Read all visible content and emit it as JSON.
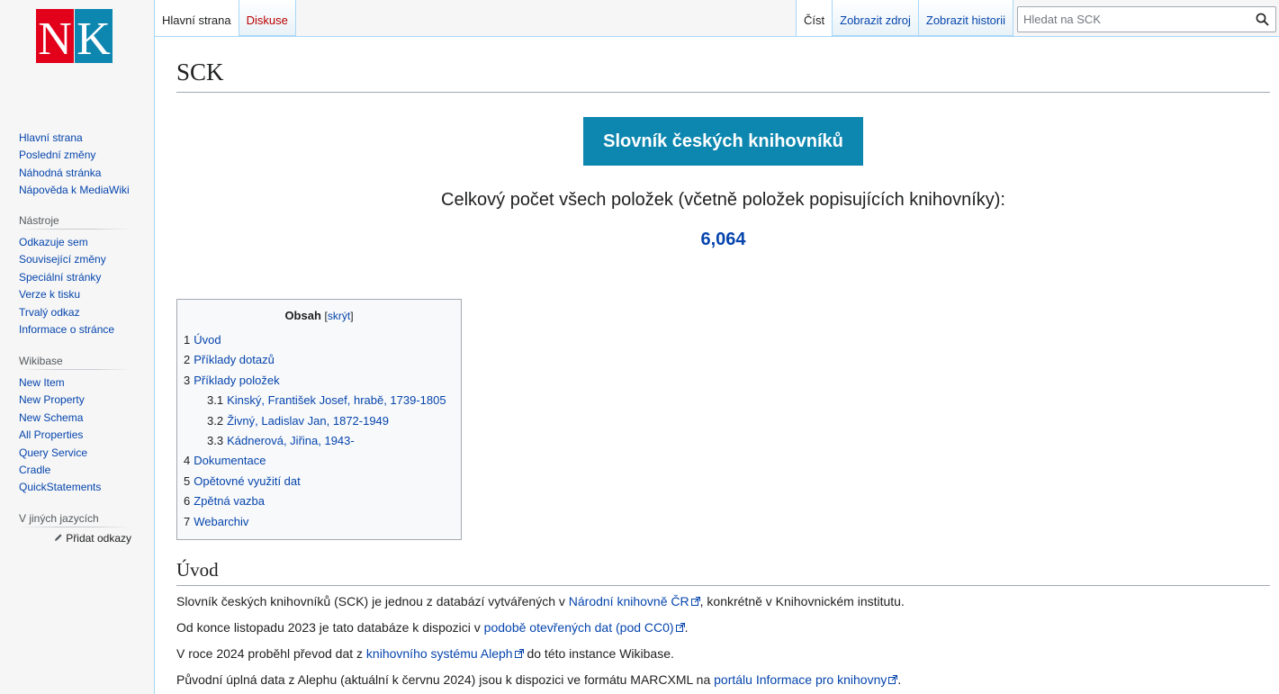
{
  "logo": {
    "letters": "NK",
    "colors": {
      "red": "#e3001b",
      "blue": "#0e87b0"
    }
  },
  "sidebar": {
    "nav": [
      {
        "label": "Hlavní strana"
      },
      {
        "label": "Poslední změny"
      },
      {
        "label": "Náhodná stránka"
      },
      {
        "label": "Nápověda k MediaWiki"
      }
    ],
    "tools": {
      "heading": "Nástroje",
      "items": [
        {
          "label": "Odkazuje sem"
        },
        {
          "label": "Související změny"
        },
        {
          "label": "Speciální stránky"
        },
        {
          "label": "Verze k tisku"
        },
        {
          "label": "Trvalý odkaz"
        },
        {
          "label": "Informace o stránce"
        }
      ]
    },
    "wikibase": {
      "heading": "Wikibase",
      "items": [
        {
          "label": "New Item"
        },
        {
          "label": "New Property"
        },
        {
          "label": "New Schema"
        },
        {
          "label": "All Properties"
        },
        {
          "label": "Query Service"
        },
        {
          "label": "Cradle"
        },
        {
          "label": "QuickStatements"
        }
      ]
    },
    "languages": {
      "heading": "V jiných jazycích",
      "add_links": "Přidat odkazy"
    }
  },
  "tabs": {
    "left": [
      {
        "label": "Hlavní strana"
      },
      {
        "label": "Diskuse"
      }
    ],
    "right": [
      {
        "label": "Číst"
      },
      {
        "label": "Zobrazit zdroj"
      },
      {
        "label": "Zobrazit historii"
      }
    ]
  },
  "search": {
    "placeholder": "Hledat na SCK"
  },
  "page": {
    "title": "SCK",
    "banner": "Slovník českých knihovníků",
    "total_label": "Celkový počet všech položek (včetně položek popisujících knihovníky):",
    "total_count": "6,064"
  },
  "toc": {
    "title": "Obsah",
    "toggle_open": "[",
    "toggle": "skrýt",
    "toggle_close": "]",
    "items": [
      {
        "num": "1",
        "label": "Úvod"
      },
      {
        "num": "2",
        "label": "Příklady dotazů"
      },
      {
        "num": "3",
        "label": "Příklady položek"
      },
      {
        "num": "3.1",
        "label": "Kinský, František Josef, hrabě, 1739-1805"
      },
      {
        "num": "3.2",
        "label": "Živný, Ladislav Jan, 1872-1949"
      },
      {
        "num": "3.3",
        "label": "Kádnerová, Jiřina, 1943-"
      },
      {
        "num": "4",
        "label": "Dokumentace"
      },
      {
        "num": "5",
        "label": "Opětovné využití dat"
      },
      {
        "num": "6",
        "label": "Zpětná vazba"
      },
      {
        "num": "7",
        "label": "Webarchiv"
      }
    ]
  },
  "intro": {
    "heading": "Úvod",
    "p1": {
      "before": "Slovník českých knihovníků (SCK) je jednou z databází vytvářených v ",
      "link": "Národní knihovně ČR",
      "after": ", konkrétně v Knihovnickém institutu."
    },
    "p2": {
      "before": "Od konce listopadu 2023 je tato databáze k dispozici v ",
      "link": "podobě otevřených dat (pod CC0)",
      "after": "."
    },
    "p3": {
      "before": "V roce 2024 proběhl převod dat z ",
      "link": "knihovního systému Aleph",
      "after": " do této instance Wikibase."
    },
    "p4": {
      "before": "Původní úplná data z Alephu (aktuální k červnu 2024) jsou k dispozici ve formátu MARCXML na ",
      "link": "portálu Informace pro knihovny",
      "after": "."
    }
  }
}
